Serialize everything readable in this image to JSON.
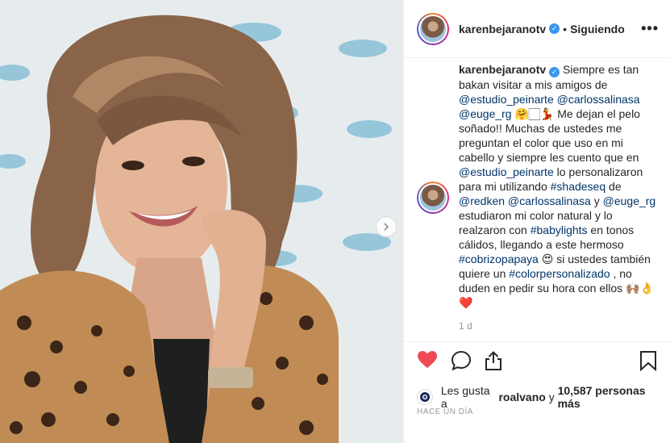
{
  "post": {
    "username": "karenbejaranotv",
    "follow_state": "Siguiendo",
    "separator": "•",
    "more_label": "•••"
  },
  "caption": {
    "username": "karenbejaranotv",
    "text_1": " Siempre es tan bakan visitar a mis amigos de ",
    "mention_1": "@estudio_peinarte",
    "sp1": " ",
    "mention_2": "@carlossalinasa",
    "sp2": " ",
    "mention_3": "@euge_rg",
    "text_2": " 🤗🏻💃 Me dejan el pelo soñado!! Muchas de ustedes me preguntan el color que uso en mi cabello y siempre les cuento que en ",
    "mention_4": "@estudio_peinarte",
    "text_3": " lo personalizaron para mi utilizando ",
    "hashtag_1": "#shadeseq",
    "text_4": " de ",
    "mention_5": "@redken",
    "sp3": " ",
    "mention_6": "@carlossalinasa",
    "text_5": " y ",
    "mention_7": "@euge_rg",
    "text_6": " estudiaron mi color natural y lo realzaron con ",
    "hashtag_2": "#babylights",
    "text_7": " en tonos cálidos, llegando a este hermoso ",
    "hashtag_3": "#cobrizopapaya",
    "text_8": " 😍 si ustedes también quiere un ",
    "hashtag_4": "#colorpersonalizado",
    "text_9": " , no duden en pedir su hora con ellos 🙌🏽👌❤️",
    "time": "1 d"
  },
  "likes": {
    "prefix": "Les gusta a ",
    "user": "roalvano",
    "middle": " y ",
    "count": "10,587 personas más"
  },
  "timestamp": "HACE UN DÍA",
  "icons": {
    "heart": "heart-icon",
    "comment": "comment-icon",
    "share": "share-icon",
    "save": "bookmark-icon",
    "next": "chevron-right-icon"
  },
  "colors": {
    "like_red": "#ed4956",
    "link_blue": "#003569",
    "verified_blue": "#3897f0",
    "muted": "#999999"
  }
}
